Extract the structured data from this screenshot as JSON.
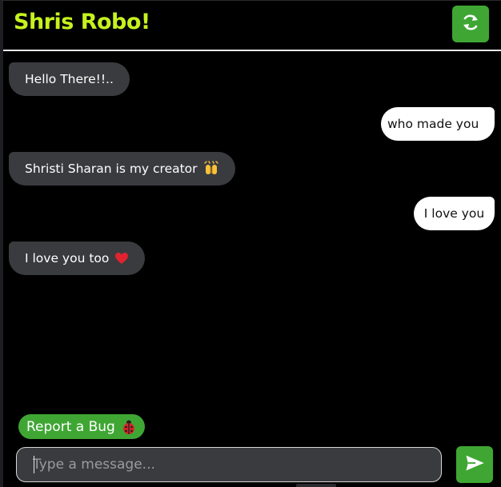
{
  "header": {
    "title": "Shris Robo!",
    "refresh_icon": "refresh-icon"
  },
  "messages": [
    {
      "sender": "bot",
      "text": "Hello There!!.."
    },
    {
      "sender": "user",
      "text": "who made you"
    },
    {
      "sender": "bot",
      "text": "Shristi Sharan is my creator",
      "emoji": "raised-hands-icon"
    },
    {
      "sender": "user",
      "text": "I love you"
    },
    {
      "sender": "bot",
      "text": "I love you too",
      "emoji": "red-heart-icon"
    }
  ],
  "report_bug": {
    "label": "Report a Bug",
    "icon": "ladybug-icon"
  },
  "composer": {
    "placeholder": "Type a message...",
    "value": "",
    "send_icon": "send-icon"
  },
  "colors": {
    "background": "#000000",
    "title": "#c6f21e",
    "accent_green": "#3fa634",
    "bot_bubble": "#3a3b3f",
    "user_bubble": "#ffffff"
  }
}
